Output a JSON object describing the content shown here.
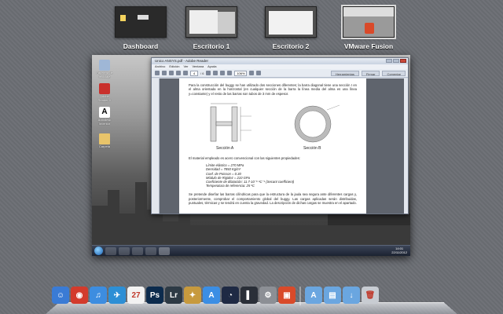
{
  "spaces": [
    {
      "label": "Dashboard",
      "active": false
    },
    {
      "label": "Escritorio 1",
      "active": false
    },
    {
      "label": "Escritorio 2",
      "active": false
    },
    {
      "label": "VMware Fusion",
      "active": true
    }
  ],
  "desktop_icons": [
    {
      "label": "Papelera de reciclaje",
      "icon": "recycle-bin-icon"
    },
    {
      "label": "Adobe Reader X",
      "icon": "adobe-reader-icon"
    },
    {
      "label": "Autodesk Inventor",
      "icon": "autodesk-icon"
    },
    {
      "label": "Carpeta",
      "icon": "folder-icon"
    }
  ],
  "pdf": {
    "title": "Unico ANSYS.pdf - Adobe Reader",
    "menu": [
      "Archivo",
      "Edición",
      "Ver",
      "Ventana",
      "Ayuda"
    ],
    "page_current": "4",
    "page_total": "/ 6",
    "zoom": "106%",
    "tools": [
      "Herramientas",
      "Firmar",
      "Comentar"
    ],
    "paragraph1": "Para la construcción del buggy se han utilizado dos secciones diferentes; la barra diagonal tiene una sección I en el alma orientada en la horizontal (en cualquier sección de la barra la línea media del alma es una línea y=constante) y el resto de las barras son tubos de 3 mm de espesor.",
    "fig_a_label": "Sección A",
    "fig_b_label": "Sección B",
    "paragraph2": "El material empleado es acero convencional con las siguientes propiedades:",
    "properties": [
      "Límite elástico = 270 MPa",
      "Densidad = 7850 Kg/m³",
      "Coef. de Poisson = 0.30",
      "Módulo de Rigidez = 210 GPa",
      "Coeficiente de dilatación: 11.7·10⁻⁶ ºC⁻¹ (Secant coefficient)",
      "Temperatura de referencia: 25 ºC"
    ],
    "paragraph3": "Se pretende diseñar las barras cilíndricas para que la estructura de la jaula sea segura ante diferentes cargas y, posteriormente, comprobar el comportamiento global del buggy. Las cargas aplicadas serán distribuidas, puntuales, térmicas y se tendrá en cuenta la gravedad. La descripción de dichas cargas se muestra en el apartado."
  },
  "taskbar": {
    "time": "14:01",
    "date": "22/11/2012"
  },
  "dock": [
    {
      "name": "finder-icon",
      "glyph": "☺",
      "color": "#3a7bd5"
    },
    {
      "name": "chrome-icon",
      "glyph": "◉",
      "color": "#d33b2c"
    },
    {
      "name": "itunes-icon",
      "glyph": "♫",
      "color": "#3d8de0"
    },
    {
      "name": "twitter-icon",
      "glyph": "✈",
      "color": "#2d8fd5"
    },
    {
      "name": "calendar-icon",
      "glyph": "27",
      "color": "#f2f2f2"
    },
    {
      "name": "photoshop-icon",
      "glyph": "Ps",
      "color": "#0c2b4d"
    },
    {
      "name": "lightroom-icon",
      "glyph": "Lr",
      "color": "#2d3a45"
    },
    {
      "name": "package-icon",
      "glyph": "✦",
      "color": "#c79a3e"
    },
    {
      "name": "app-store-icon",
      "glyph": "A",
      "color": "#3b8ee4"
    },
    {
      "name": "cinema4d-icon",
      "glyph": "◔",
      "color": "#1f2a44"
    },
    {
      "name": "terminal-icon",
      "glyph": "▌",
      "color": "#2a2f38"
    },
    {
      "name": "system-preferences-icon",
      "glyph": "⚙",
      "color": "#8c8f95"
    },
    {
      "name": "vmware-fusion-icon",
      "glyph": "▣",
      "color": "#d94a2a"
    },
    {
      "name": "applications-folder-icon",
      "glyph": "A",
      "color": "#6aa6e0"
    },
    {
      "name": "documents-folder-icon",
      "glyph": "▤",
      "color": "#6aa6e0"
    },
    {
      "name": "downloads-folder-icon",
      "glyph": "↓",
      "color": "#6aa6e0"
    },
    {
      "name": "trash-icon",
      "glyph": "🗑",
      "color": "#c8ccd2"
    }
  ]
}
